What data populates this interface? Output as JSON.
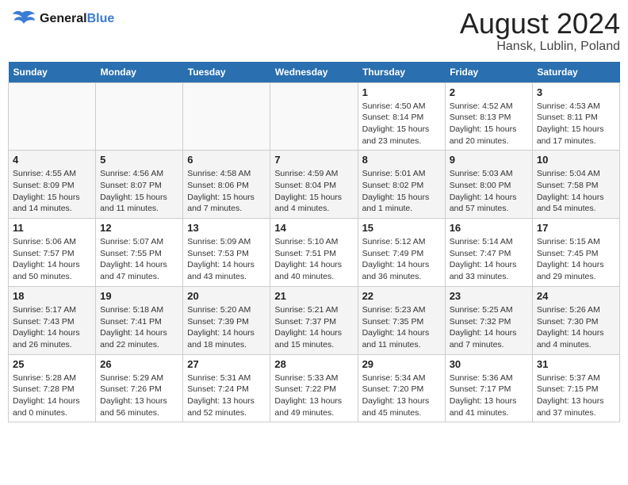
{
  "header": {
    "logo_line1": "General",
    "logo_line2": "Blue",
    "month_title": "August 2024",
    "location": "Hansk, Lublin, Poland"
  },
  "weekdays": [
    "Sunday",
    "Monday",
    "Tuesday",
    "Wednesday",
    "Thursday",
    "Friday",
    "Saturday"
  ],
  "weeks": [
    [
      {
        "day": "",
        "info": ""
      },
      {
        "day": "",
        "info": ""
      },
      {
        "day": "",
        "info": ""
      },
      {
        "day": "",
        "info": ""
      },
      {
        "day": "1",
        "info": "Sunrise: 4:50 AM\nSunset: 8:14 PM\nDaylight: 15 hours\nand 23 minutes."
      },
      {
        "day": "2",
        "info": "Sunrise: 4:52 AM\nSunset: 8:13 PM\nDaylight: 15 hours\nand 20 minutes."
      },
      {
        "day": "3",
        "info": "Sunrise: 4:53 AM\nSunset: 8:11 PM\nDaylight: 15 hours\nand 17 minutes."
      }
    ],
    [
      {
        "day": "4",
        "info": "Sunrise: 4:55 AM\nSunset: 8:09 PM\nDaylight: 15 hours\nand 14 minutes."
      },
      {
        "day": "5",
        "info": "Sunrise: 4:56 AM\nSunset: 8:07 PM\nDaylight: 15 hours\nand 11 minutes."
      },
      {
        "day": "6",
        "info": "Sunrise: 4:58 AM\nSunset: 8:06 PM\nDaylight: 15 hours\nand 7 minutes."
      },
      {
        "day": "7",
        "info": "Sunrise: 4:59 AM\nSunset: 8:04 PM\nDaylight: 15 hours\nand 4 minutes."
      },
      {
        "day": "8",
        "info": "Sunrise: 5:01 AM\nSunset: 8:02 PM\nDaylight: 15 hours\nand 1 minute."
      },
      {
        "day": "9",
        "info": "Sunrise: 5:03 AM\nSunset: 8:00 PM\nDaylight: 14 hours\nand 57 minutes."
      },
      {
        "day": "10",
        "info": "Sunrise: 5:04 AM\nSunset: 7:58 PM\nDaylight: 14 hours\nand 54 minutes."
      }
    ],
    [
      {
        "day": "11",
        "info": "Sunrise: 5:06 AM\nSunset: 7:57 PM\nDaylight: 14 hours\nand 50 minutes."
      },
      {
        "day": "12",
        "info": "Sunrise: 5:07 AM\nSunset: 7:55 PM\nDaylight: 14 hours\nand 47 minutes."
      },
      {
        "day": "13",
        "info": "Sunrise: 5:09 AM\nSunset: 7:53 PM\nDaylight: 14 hours\nand 43 minutes."
      },
      {
        "day": "14",
        "info": "Sunrise: 5:10 AM\nSunset: 7:51 PM\nDaylight: 14 hours\nand 40 minutes."
      },
      {
        "day": "15",
        "info": "Sunrise: 5:12 AM\nSunset: 7:49 PM\nDaylight: 14 hours\nand 36 minutes."
      },
      {
        "day": "16",
        "info": "Sunrise: 5:14 AM\nSunset: 7:47 PM\nDaylight: 14 hours\nand 33 minutes."
      },
      {
        "day": "17",
        "info": "Sunrise: 5:15 AM\nSunset: 7:45 PM\nDaylight: 14 hours\nand 29 minutes."
      }
    ],
    [
      {
        "day": "18",
        "info": "Sunrise: 5:17 AM\nSunset: 7:43 PM\nDaylight: 14 hours\nand 26 minutes."
      },
      {
        "day": "19",
        "info": "Sunrise: 5:18 AM\nSunset: 7:41 PM\nDaylight: 14 hours\nand 22 minutes."
      },
      {
        "day": "20",
        "info": "Sunrise: 5:20 AM\nSunset: 7:39 PM\nDaylight: 14 hours\nand 18 minutes."
      },
      {
        "day": "21",
        "info": "Sunrise: 5:21 AM\nSunset: 7:37 PM\nDaylight: 14 hours\nand 15 minutes."
      },
      {
        "day": "22",
        "info": "Sunrise: 5:23 AM\nSunset: 7:35 PM\nDaylight: 14 hours\nand 11 minutes."
      },
      {
        "day": "23",
        "info": "Sunrise: 5:25 AM\nSunset: 7:32 PM\nDaylight: 14 hours\nand 7 minutes."
      },
      {
        "day": "24",
        "info": "Sunrise: 5:26 AM\nSunset: 7:30 PM\nDaylight: 14 hours\nand 4 minutes."
      }
    ],
    [
      {
        "day": "25",
        "info": "Sunrise: 5:28 AM\nSunset: 7:28 PM\nDaylight: 14 hours\nand 0 minutes."
      },
      {
        "day": "26",
        "info": "Sunrise: 5:29 AM\nSunset: 7:26 PM\nDaylight: 13 hours\nand 56 minutes."
      },
      {
        "day": "27",
        "info": "Sunrise: 5:31 AM\nSunset: 7:24 PM\nDaylight: 13 hours\nand 52 minutes."
      },
      {
        "day": "28",
        "info": "Sunrise: 5:33 AM\nSunset: 7:22 PM\nDaylight: 13 hours\nand 49 minutes."
      },
      {
        "day": "29",
        "info": "Sunrise: 5:34 AM\nSunset: 7:20 PM\nDaylight: 13 hours\nand 45 minutes."
      },
      {
        "day": "30",
        "info": "Sunrise: 5:36 AM\nSunset: 7:17 PM\nDaylight: 13 hours\nand 41 minutes."
      },
      {
        "day": "31",
        "info": "Sunrise: 5:37 AM\nSunset: 7:15 PM\nDaylight: 13 hours\nand 37 minutes."
      }
    ]
  ]
}
